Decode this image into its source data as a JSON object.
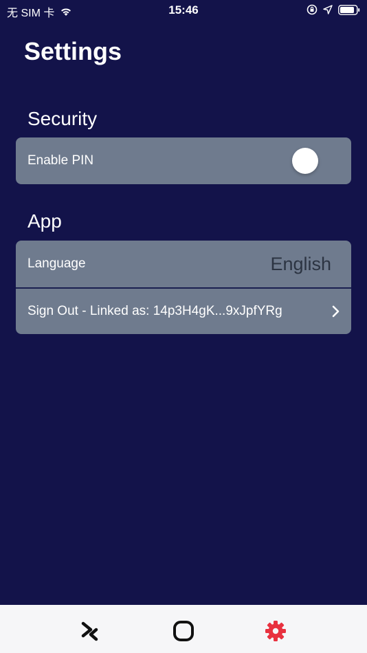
{
  "status_bar": {
    "carrier": "无 SIM 卡",
    "time": "15:46"
  },
  "page": {
    "title": "Settings"
  },
  "sections": {
    "security": {
      "title": "Security",
      "enable_pin_label": "Enable PIN",
      "enable_pin_on": false
    },
    "app": {
      "title": "App",
      "language_label": "Language",
      "language_value": "English",
      "sign_out_label": "Sign Out - Linked as: 14p3H4gK...9xJpfYRg"
    }
  },
  "tab_bar": {
    "tabs": [
      {
        "icon": "swap-icon",
        "active": false
      },
      {
        "icon": "square-icon",
        "active": false
      },
      {
        "icon": "gear-icon",
        "active": true
      }
    ],
    "active_color": "#e8313f",
    "inactive_color": "#111111"
  },
  "colors": {
    "background": "#13134a",
    "card": "#6f7b8e"
  }
}
